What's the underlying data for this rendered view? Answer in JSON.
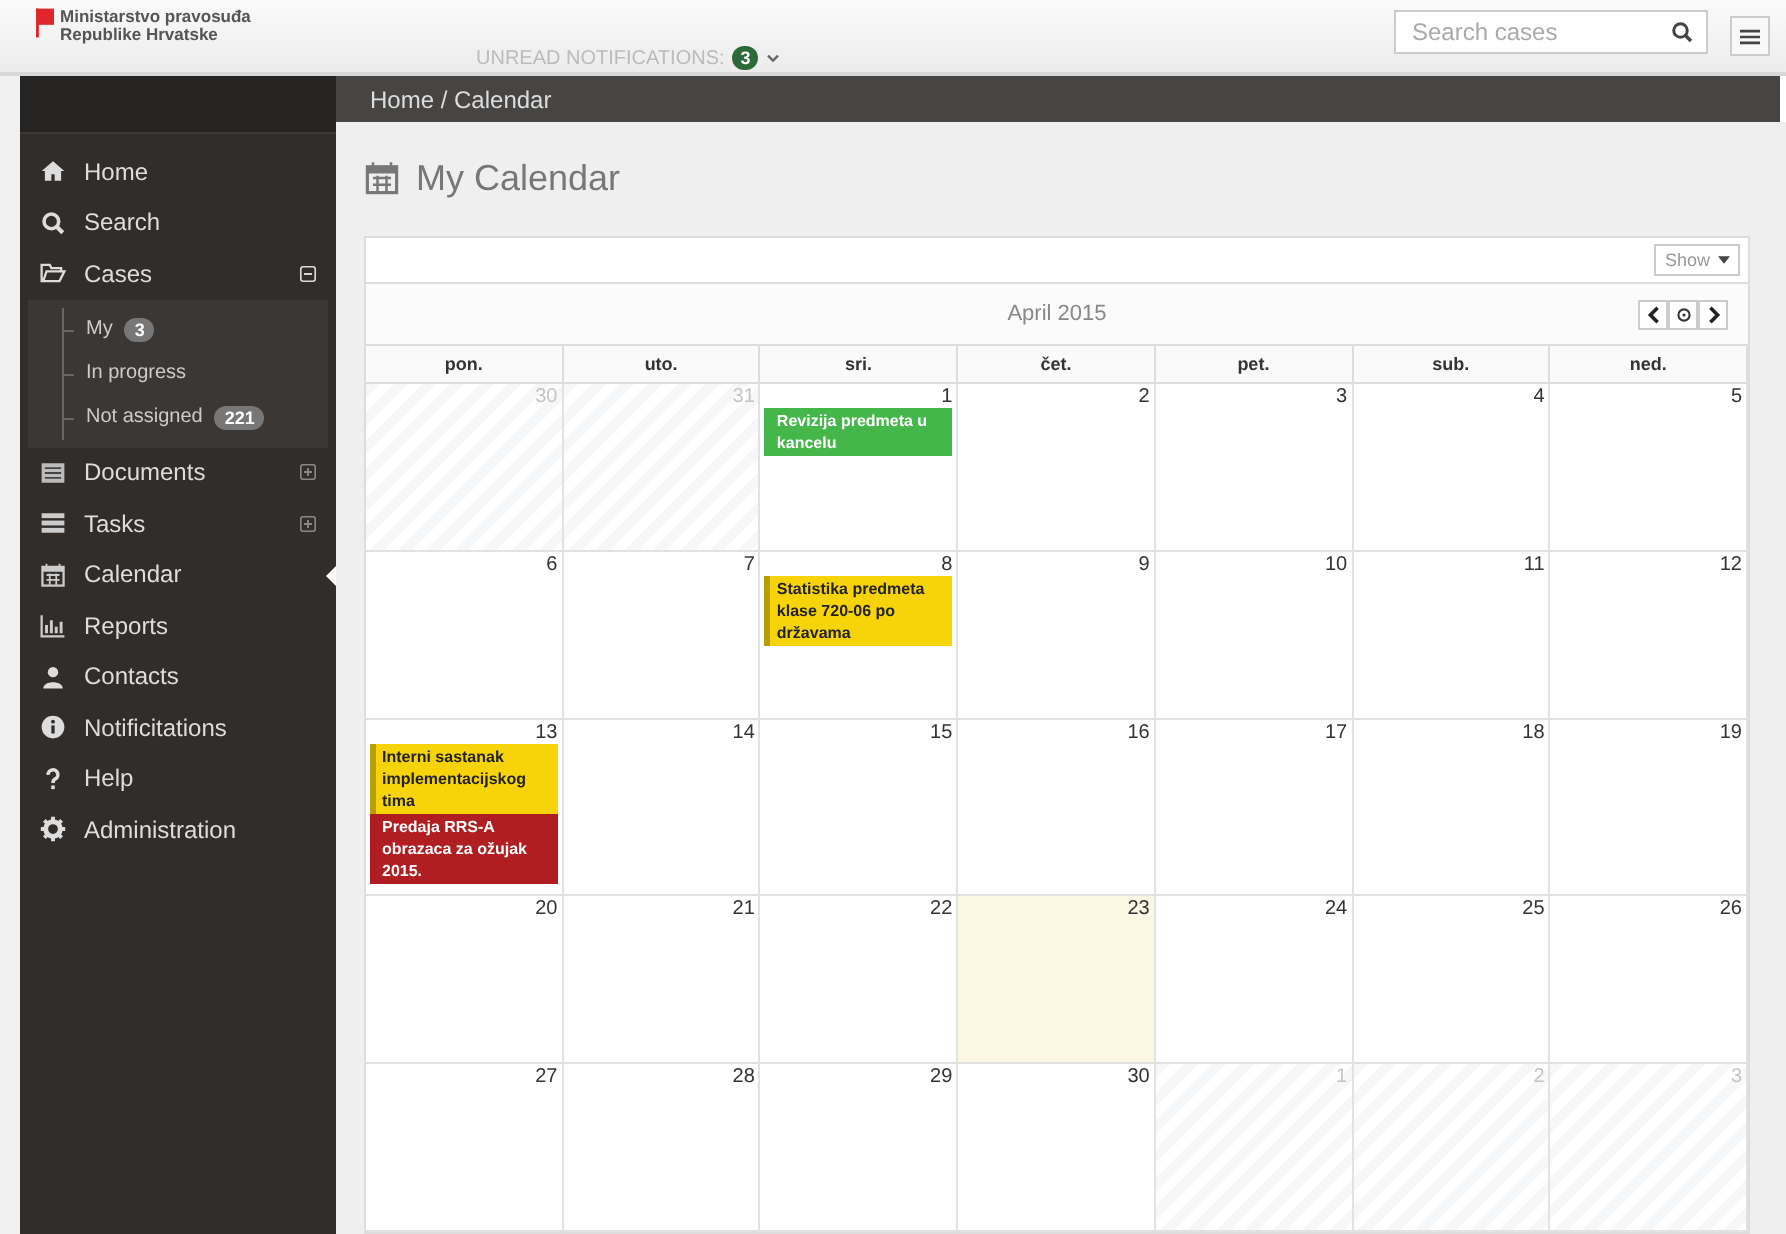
{
  "header": {
    "logo_line1": "Ministarstvo pravosuđa",
    "logo_line2": "Republike Hrvatske",
    "notifications_label": "UNREAD NOTIFICATIONS:",
    "notifications_count": "3",
    "search": {
      "placeholder": "Search cases"
    }
  },
  "breadcrumb": "Home / Calendar",
  "sidebar": {
    "items": [
      {
        "label": "Home",
        "kind": "home",
        "selected": false
      },
      {
        "label": "Search",
        "kind": "search",
        "selected": false
      },
      {
        "label": "Cases",
        "kind": "folder",
        "selected": false,
        "expanded": true,
        "children": [
          {
            "label": "My",
            "badge": "3"
          },
          {
            "label": "In progress"
          },
          {
            "label": "Not assigned",
            "badge": "221"
          }
        ]
      },
      {
        "label": "Documents",
        "kind": "document",
        "selected": false,
        "expanded": false
      },
      {
        "label": "Tasks",
        "kind": "tasks",
        "selected": false,
        "expanded": false
      },
      {
        "label": "Calendar",
        "kind": "calendar",
        "selected": true
      },
      {
        "label": "Reports",
        "kind": "chart",
        "selected": false
      },
      {
        "label": "Contacts",
        "kind": "person",
        "selected": false
      },
      {
        "label": "Notificitations",
        "kind": "info",
        "selected": false
      },
      {
        "label": "Help",
        "kind": "help",
        "selected": false
      },
      {
        "label": "Administration",
        "kind": "gear",
        "selected": false
      }
    ]
  },
  "page_title": "My Calendar",
  "calendar": {
    "show_button": "Show",
    "month": "April 2015",
    "weekdays": [
      "pon.",
      "uto.",
      "sri.",
      "čet.",
      "pet.",
      "sub.",
      "ned."
    ],
    "weeks": [
      [
        {
          "day": "30",
          "outside": true,
          "today": false
        },
        {
          "day": "31",
          "outside": true,
          "today": false
        },
        {
          "day": "1",
          "outside": false,
          "today": false,
          "events": [
            {
              "title": "Revizija predmeta u kancelu",
              "color": "#45b649"
            }
          ]
        },
        {
          "day": "2",
          "outside": false,
          "today": false
        },
        {
          "day": "3",
          "outside": false,
          "today": false
        },
        {
          "day": "4",
          "outside": false,
          "today": false
        },
        {
          "day": "5",
          "outside": false,
          "today": false
        }
      ],
      [
        {
          "day": "6",
          "outside": false,
          "today": false
        },
        {
          "day": "7",
          "outside": false,
          "today": false
        },
        {
          "day": "8",
          "outside": false,
          "today": false,
          "events": [
            {
              "title": "Statistika predmeta klase 720-06 po državama",
              "color": "#f7d40a"
            }
          ]
        },
        {
          "day": "9",
          "outside": false,
          "today": false
        },
        {
          "day": "10",
          "outside": false,
          "today": false
        },
        {
          "day": "11",
          "outside": false,
          "today": false
        },
        {
          "day": "12",
          "outside": false,
          "today": false
        }
      ],
      [
        {
          "day": "13",
          "outside": false,
          "today": false,
          "events": [
            {
              "title": "Interni sastanak implementacijskog tima",
              "color": "#f7d40a"
            },
            {
              "title": "Predaja RRS-A obrazaca za ožujak 2015.",
              "color": "#b01e22"
            }
          ]
        },
        {
          "day": "14",
          "outside": false,
          "today": false
        },
        {
          "day": "15",
          "outside": false,
          "today": false
        },
        {
          "day": "16",
          "outside": false,
          "today": false
        },
        {
          "day": "17",
          "outside": false,
          "today": false
        },
        {
          "day": "18",
          "outside": false,
          "today": false
        },
        {
          "day": "19",
          "outside": false,
          "today": false
        }
      ],
      [
        {
          "day": "20",
          "outside": false,
          "today": false
        },
        {
          "day": "21",
          "outside": false,
          "today": false
        },
        {
          "day": "22",
          "outside": false,
          "today": false
        },
        {
          "day": "23",
          "outside": false,
          "today": true
        },
        {
          "day": "24",
          "outside": false,
          "today": false
        },
        {
          "day": "25",
          "outside": false,
          "today": false
        },
        {
          "day": "26",
          "outside": false,
          "today": false
        }
      ],
      [
        {
          "day": "27",
          "outside": false,
          "today": false
        },
        {
          "day": "28",
          "outside": false,
          "today": false
        },
        {
          "day": "29",
          "outside": false,
          "today": false
        },
        {
          "day": "30",
          "outside": false,
          "today": false
        },
        {
          "day": "1",
          "outside": true,
          "today": false
        },
        {
          "day": "2",
          "outside": true,
          "today": false
        },
        {
          "day": "3",
          "outside": true,
          "today": false
        }
      ]
    ]
  }
}
